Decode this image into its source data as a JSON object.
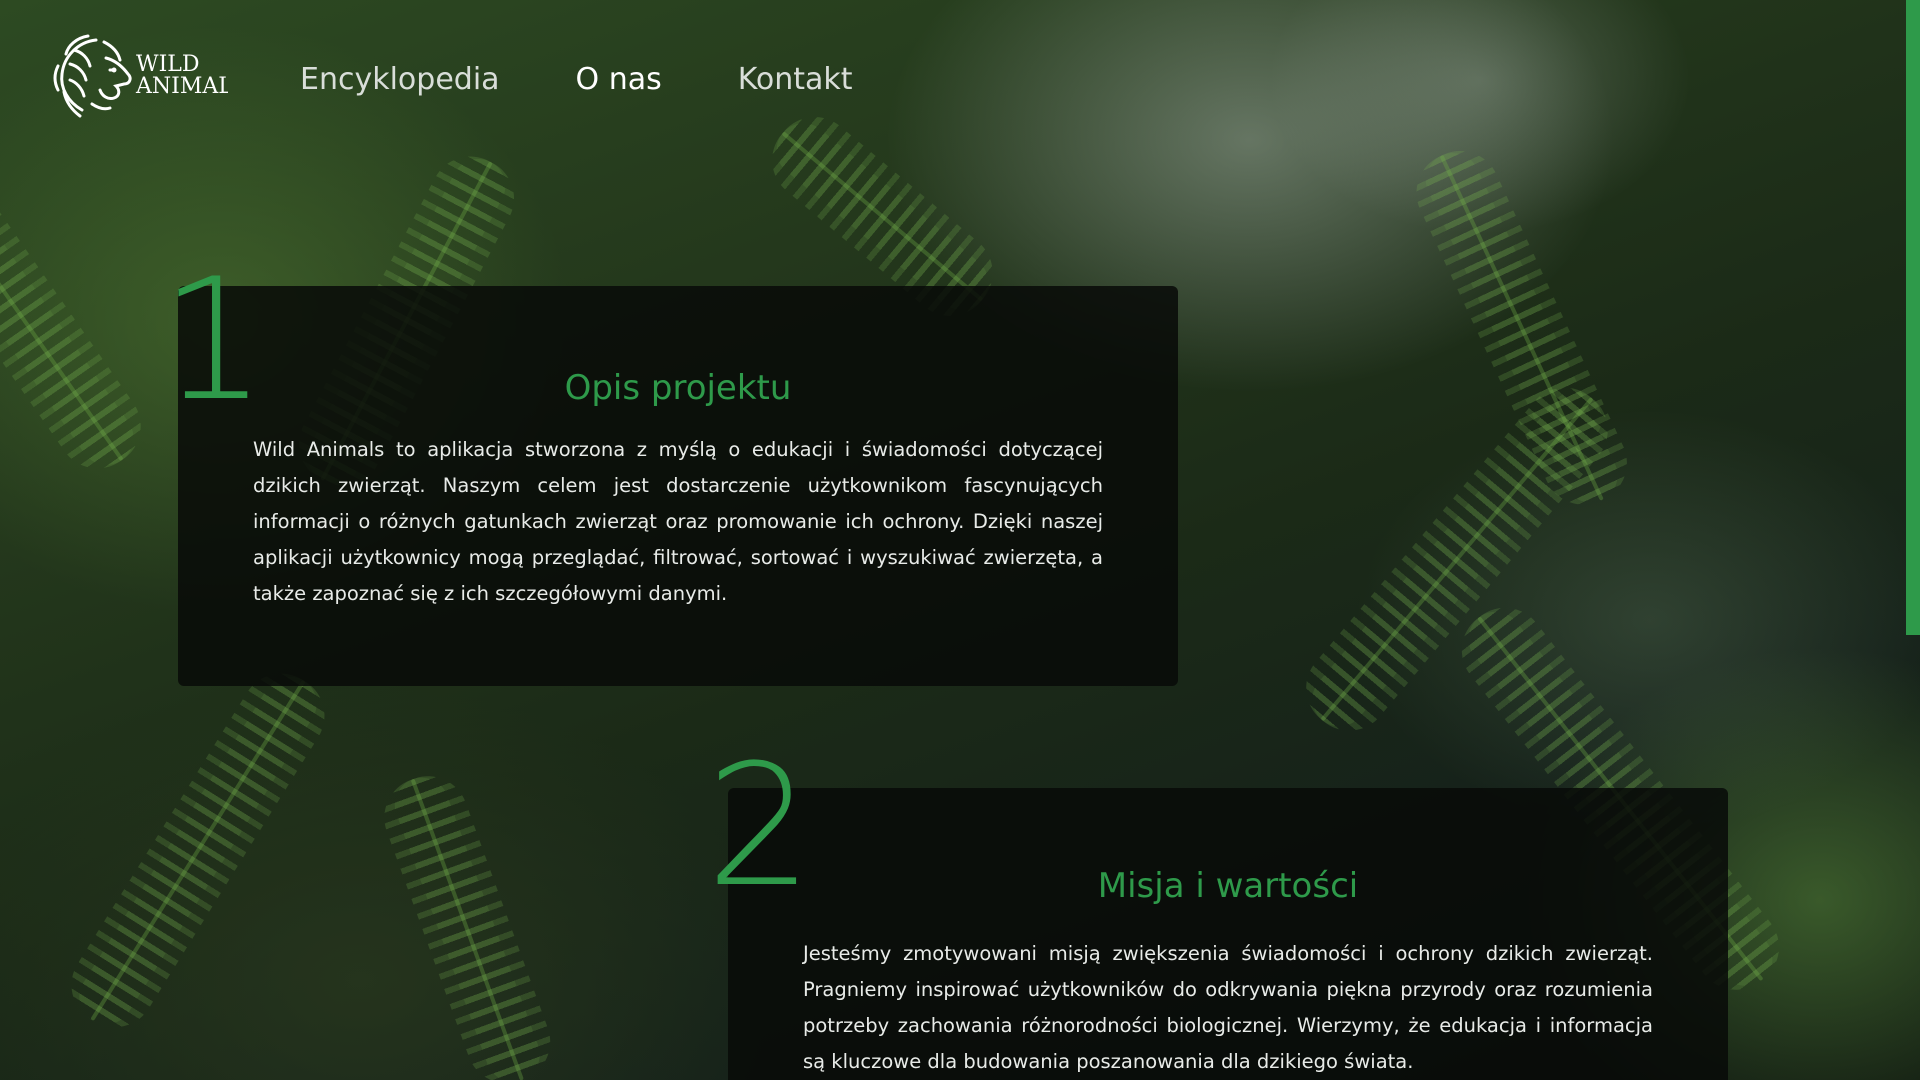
{
  "logo": {
    "line1": "WILD",
    "line2": "ANIMAL"
  },
  "nav": {
    "items": [
      {
        "label": "Encyklopedia",
        "active": false
      },
      {
        "label": "O nas",
        "active": true
      },
      {
        "label": "Kontakt",
        "active": false
      }
    ]
  },
  "sections": [
    {
      "number": "1",
      "title": "Opis projektu",
      "text": "Wild Animals to aplikacja stworzona z myślą o edukacji i świadomości dotyczącej dzikich zwierząt. Naszym celem jest dostarczenie użytkownikom fascynujących informacji o różnych gatunkach zwierząt oraz promowanie ich ochrony. Dzięki naszej aplikacji użytkownicy mogą przeglądać, filtrować, sortować i wyszukiwać zwierzęta, a także zapoznać się z ich szczegółowymi danymi."
    },
    {
      "number": "2",
      "title": "Misja i wartości",
      "text": "Jesteśmy zmotywowani misją zwiększenia świadomości i ochrony dzikich zwierząt. Pragniemy inspirować użytkowników do odkrywania piękna przyrody oraz rozumienia potrzeby zachowania różnorodności biologicznej. Wierzymy, że edukacja i informacja są kluczowe dla budowania poszanowania dla dzikiego świata."
    }
  ],
  "colors": {
    "accent": "#2e9a4a",
    "card_bg": "#080a08",
    "nav_text": "#d9ded9"
  }
}
